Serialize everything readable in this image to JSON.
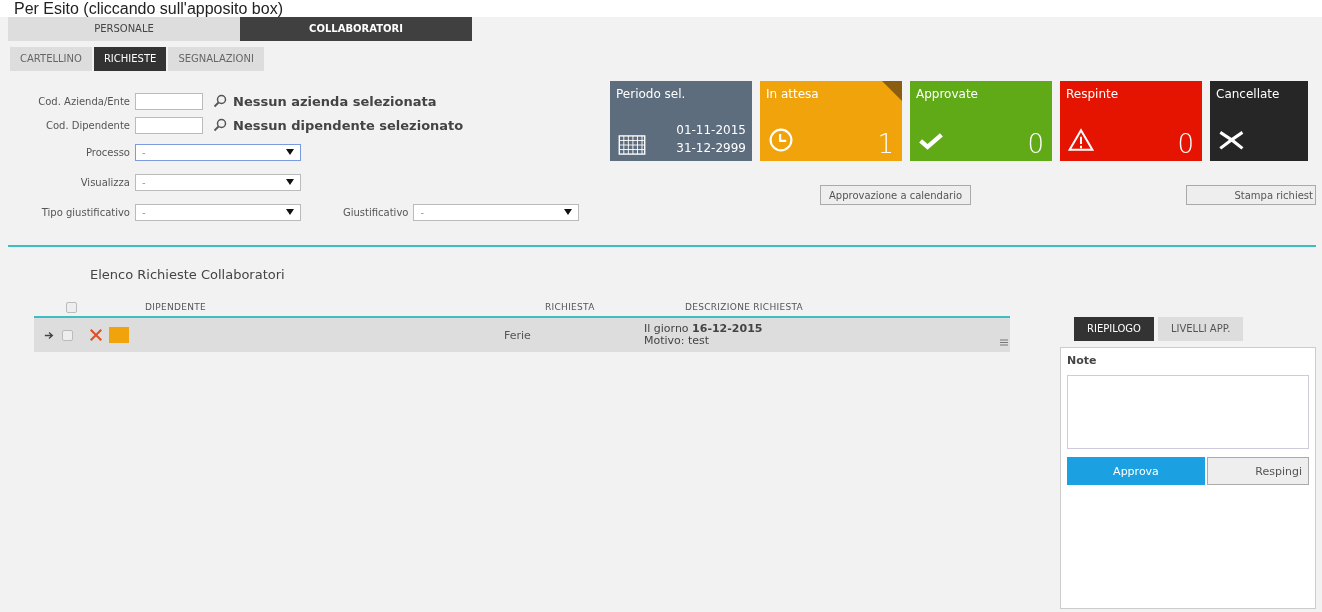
{
  "caption": "Per Esito (cliccando sull'apposito box)",
  "main_tabs": [
    {
      "label": "PERSONALE",
      "selected": false
    },
    {
      "label": "COLLABORATORI",
      "selected": true
    }
  ],
  "sub_tabs": [
    {
      "label": "CARTELLINO",
      "selected": false
    },
    {
      "label": "RICHIESTE",
      "selected": true
    },
    {
      "label": "SEGNALAZIONI",
      "selected": false
    }
  ],
  "lookups": [
    {
      "label": "Cod. Azienda/Ente",
      "result": "Nessun azienda selezionata"
    },
    {
      "label": "Cod. Dipendente",
      "result": "Nessun dipendente selezionato"
    }
  ],
  "selects": [
    {
      "label": "Processo",
      "value": "-",
      "focused": true
    },
    {
      "label": "Visualizza",
      "value": "-",
      "focused": false
    }
  ],
  "tipo": {
    "label": "Tipo giustificativo",
    "value": "-"
  },
  "giustificativo": {
    "label": "Giustificativo",
    "value": "-"
  },
  "tiles": [
    {
      "kind": "period",
      "title": "Periodo sel.",
      "from": "01-11-2015",
      "to": "31-12-2999",
      "selected": false
    },
    {
      "kind": "pending",
      "title": "In attesa",
      "count": "1",
      "selected": true
    },
    {
      "kind": "approved",
      "title": "Approvate",
      "count": "0",
      "selected": false
    },
    {
      "kind": "rejected",
      "title": "Respinte",
      "count": "0",
      "selected": false
    },
    {
      "kind": "cancelled",
      "title": "Cancellate",
      "selected": false
    }
  ],
  "buttons": {
    "calendar": "Approvazione a calendario",
    "print": "Stampa richiest"
  },
  "list": {
    "title": "Elenco Richieste Collaboratori",
    "all_checked": false,
    "columns": [
      "DIPENDENTE",
      "RICHIESTA",
      "DESCRIZIONE RICHIESTA"
    ],
    "rows": [
      {
        "checked": false,
        "richiesta": "Ferie",
        "descrizione": "Il giorno **16-12-2015**",
        "motivo": "Motivo: test",
        "color": "#f0a30a"
      }
    ]
  },
  "detail": {
    "tabs": [
      {
        "label": "RIEPILOGO",
        "selected": true
      },
      {
        "label": "LIVELLI APP.",
        "selected": false
      }
    ],
    "notes_label": "Note",
    "approve": "Approva",
    "reject": "Respingi"
  }
}
